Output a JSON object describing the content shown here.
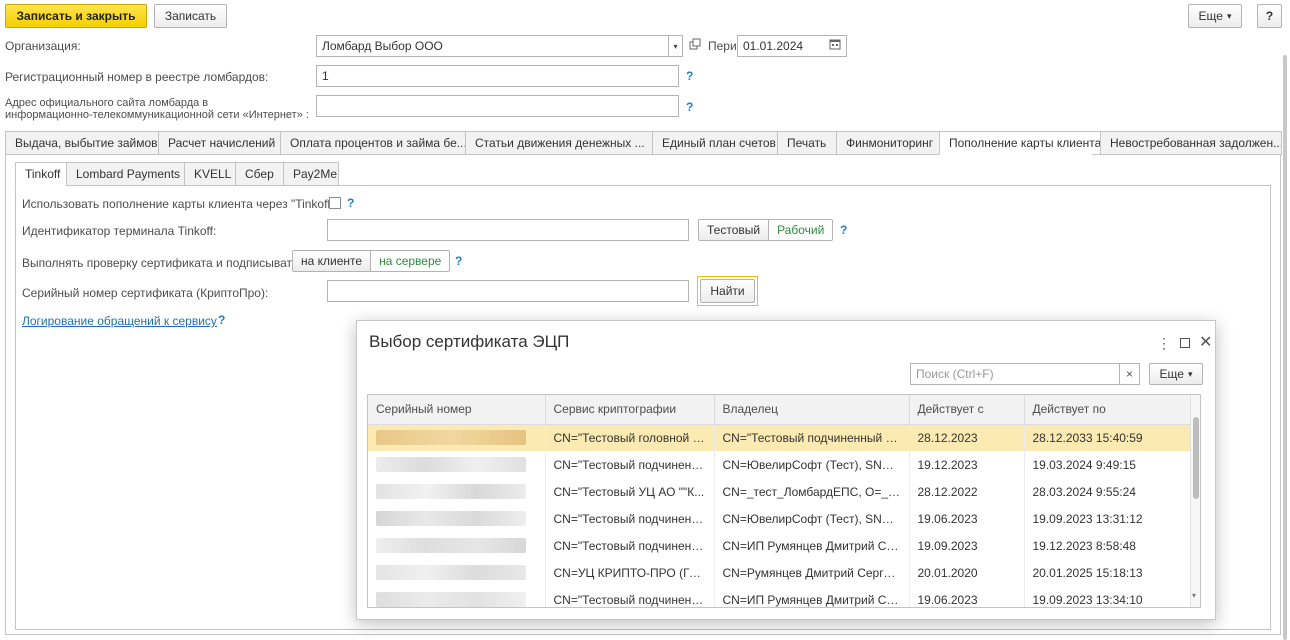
{
  "toolbar": {
    "save_close": "Записать и закрыть",
    "save": "Записать",
    "more": "Еще",
    "more_arrow": "▾",
    "help": "?"
  },
  "form": {
    "org_label": "Организация:",
    "org_value": "Ломбард Выбор ООО",
    "period_label": "Период:",
    "period_value": "01.01.2024",
    "reg_label": "Регистрационный номер в реестре ломбардов:",
    "reg_value": "1",
    "address_label_1": "Адрес официального сайта ломбарда в",
    "address_label_2": "информационно-телекоммуникационной сети «Интернет» :",
    "address_value": "",
    "help": "?"
  },
  "main_tabs": [
    "Выдача, выбытие займов",
    "Расчет начислений",
    "Оплата процентов и займа бе...",
    "Статьи движения денежных ...",
    "Единый план счетов",
    "Печать",
    "Финмониторинг",
    "Пополнение карты клиента",
    "Невостребованная задолжен..."
  ],
  "sub_tabs": [
    "Tinkoff",
    "Lombard Payments",
    "KVELL",
    "Сбер",
    "Pay2Me"
  ],
  "tinkoff": {
    "use_label": "Использовать пополнение карты клиента через \"Tinkoff\":",
    "terminal_label": "Идентификатор терминала Tinkoff:",
    "terminal_value": "",
    "mode_test": "Тестовый",
    "mode_work": "Рабочий",
    "verify_label": "Выполнять проверку сертификата и подписывать:",
    "verify_client": "на клиенте",
    "verify_server": "на сервере",
    "serial_label": "Серийный номер сертификата (КриптоПро):",
    "serial_value": "",
    "find": "Найти",
    "log_link": "Логирование обращений к сервису"
  },
  "dialog": {
    "title": "Выбор сертификата ЭЦП",
    "search_placeholder": "Поиск (Ctrl+F)",
    "clear": "×",
    "more": "Еще",
    "columns": [
      "Серийный номер",
      "Сервис криптографии",
      "Владелец",
      "Действует с",
      "Действует по"
    ],
    "rows": [
      {
        "service": "CN=\"Тестовый головной У...",
        "owner": "CN=\"Тестовый подчиненный УЦ...",
        "from": "28.12.2023",
        "to": "28.12.2033 15:40:59"
      },
      {
        "service": "CN=\"Тестовый подчиненн...",
        "owner": "CN=ЮвелирСофт (Тест), SN=Ру...",
        "from": "19.12.2023",
        "to": "19.03.2024 9:49:15"
      },
      {
        "service": "CN=\"Тестовый УЦ АО \"\"К...",
        "owner": "CN=_тест_ЛомбардЕПС, O=_те...",
        "from": "28.12.2022",
        "to": "28.03.2024 9:55:24"
      },
      {
        "service": "CN=\"Тестовый подчиненн...",
        "owner": "CN=ЮвелирСофт (Тест), SN=Ру...",
        "from": "19.06.2023",
        "to": "19.09.2023 13:31:12"
      },
      {
        "service": "CN=\"Тестовый подчиненн...",
        "owner": "CN=ИП Румянцев Дмитрий Сер...",
        "from": "19.09.2023",
        "to": "19.12.2023 8:58:48"
      },
      {
        "service": "CN=УЦ КРИПТО-ПРО (ГО...",
        "owner": "CN=Румянцев Дмитрий Сергее...",
        "from": "20.01.2020",
        "to": "20.01.2025 15:18:13"
      },
      {
        "service": "CN=\"Тестовый подчиненн...",
        "owner": "CN=ИП Румянцев Дмитрий Сер...",
        "from": "19.06.2023",
        "to": "19.09.2023 13:34:10"
      }
    ]
  },
  "colors": {
    "accent_yellow": "#f5d000",
    "link_blue": "#1f7fc7",
    "active_green": "#2e8b3a",
    "selected_row": "#fbeab1"
  }
}
